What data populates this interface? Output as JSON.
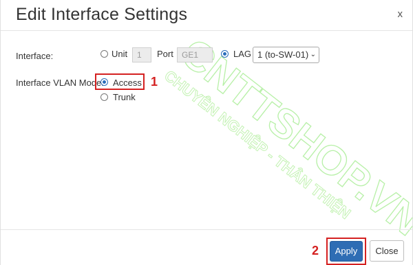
{
  "dialog": {
    "title": "Edit Interface Settings",
    "close_glyph": "x"
  },
  "interface_row": {
    "label": "Interface:",
    "unit_label": "Unit",
    "unit_value": "1",
    "port_label": "Port",
    "port_value": "GE1",
    "lag_label": "LAG",
    "lag_selected": "1 (to-SW-01)",
    "selected_option": "LAG"
  },
  "vlan_mode_row": {
    "label": "Interface VLAN Mode:",
    "access_label": "Access",
    "trunk_label": "Trunk",
    "selected_option": "Access"
  },
  "annotations": {
    "step1": "1",
    "step2": "2",
    "color": "#d42020"
  },
  "footer": {
    "apply_label": "Apply",
    "close_label": "Close"
  },
  "colors": {
    "primary": "#2e6db4",
    "radio_selected": "#2a6ebb"
  },
  "watermark": {
    "brand_text": "CNTTSHOP.VN",
    "tagline": "CHUYÊN NGHIỆP - THÂN THIỆN"
  }
}
